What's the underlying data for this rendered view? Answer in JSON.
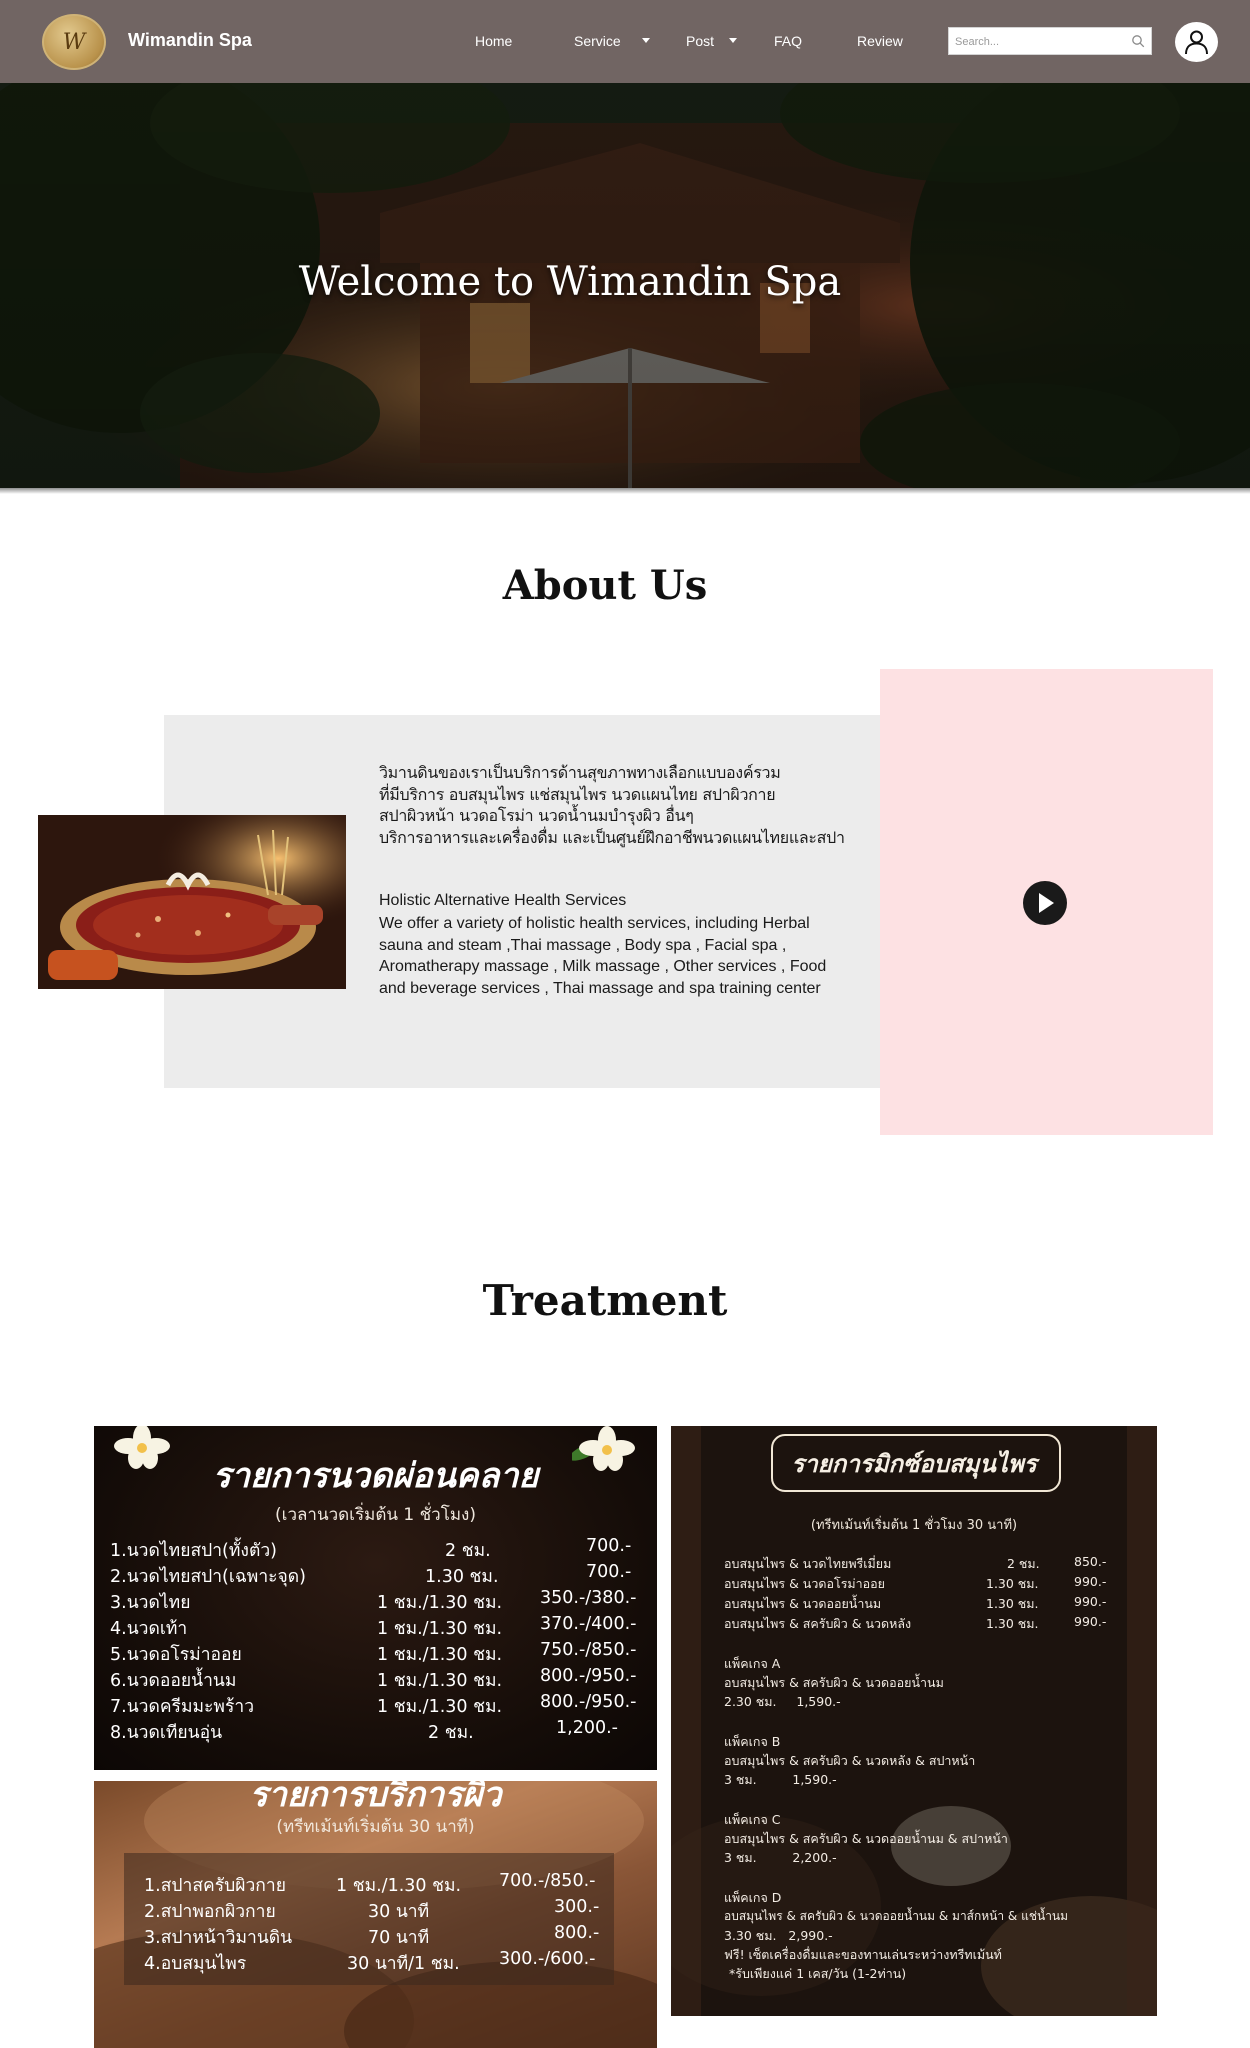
{
  "nav": {
    "brand": "Wimandin Spa",
    "logo_letter": "W",
    "items": [
      {
        "label": "Home",
        "dropdown": false
      },
      {
        "label": "Service",
        "dropdown": true
      },
      {
        "label": "Post",
        "dropdown": true
      },
      {
        "label": "FAQ",
        "dropdown": false
      },
      {
        "label": "Review",
        "dropdown": false
      }
    ],
    "search_placeholder": "Search...",
    "icons": {
      "search": "search-icon",
      "user": "user-icon"
    }
  },
  "hero": {
    "title": "Welcome to Wimandin Spa"
  },
  "about": {
    "title": "About Us",
    "thai_lines": [
      "วิมานดินของเราเป็นบริการด้านสุขภาพทางเลือกแบบองค์รวม",
      "ที่มีบริการ อบสมุนไพร แช่สมุนไพร นวดแผนไทย สปาผิวกาย",
      "สปาผิวหน้า นวดอโรม่า นวดน้ำนมบำรุงผิว อื่นๆ",
      "บริการอาหารและเครื่องดื่ม และเป็นศูนย์ฝึกอาชีพนวดแผนไทยและสปา"
    ],
    "english_title": "Holistic Alternative Health Services",
    "english_lines": [
      "We offer a variety of holistic health services, including Herbal",
      "sauna and steam ,Thai massage , Body spa , Facial spa ,",
      "Aromatherapy massage , Milk massage , Other services , Food",
      "and beverage services , Thai massage and spa training center"
    ],
    "video_icon": "play-icon"
  },
  "treatment": {
    "title": "Treatment",
    "massage_menu": {
      "title": "รายการนวดผ่อนคลาย",
      "subtitle": "(เวลานวดเริ่มต้น 1 ชั่วโมง)",
      "items": [
        {
          "name": "1.นวดไทยสปา(ทั้งตัว)",
          "duration": "2 ชม.",
          "price": "700.-"
        },
        {
          "name": "2.นวดไทยสปา(เฉพาะจุด)",
          "duration": "1.30 ชม.",
          "price": "700.-"
        },
        {
          "name": "3.นวดไทย",
          "duration": "1 ชม./1.30 ชม.",
          "price": "350.-/380.-"
        },
        {
          "name": "4.นวดเท้า",
          "duration": "1 ชม./1.30 ชม.",
          "price": "370.-/400.-"
        },
        {
          "name": "5.นวดอโรม่าออย",
          "duration": "1 ชม./1.30 ชม.",
          "price": "750.-/850.-"
        },
        {
          "name": "6.นวดออยน้ำนม",
          "duration": "1 ชม./1.30 ชม.",
          "price": "800.-/950.-"
        },
        {
          "name": "7.นวดครีมมะพร้าว",
          "duration": "1 ชม./1.30 ชม.",
          "price": "800.-/950.-"
        },
        {
          "name": "8.นวดเทียนอุ่น",
          "duration": "2  ชม.",
          "price": "1,200.-"
        }
      ]
    },
    "skin_menu": {
      "title": "รายการบริการผิว",
      "subtitle": "(ทรีทเม้นท์เริ่มต้น 30 นาที)",
      "items": [
        {
          "name": "1.สปาสครับผิวกาย",
          "duration": "1 ชม./1.30 ชม.",
          "price": "700.-/850.-"
        },
        {
          "name": "2.สปาพอกผิวกาย",
          "duration": "30 นาที",
          "price": "300.-"
        },
        {
          "name": "3.สปาหน้าวิมานดิน",
          "duration": "70 นาที",
          "price": "800.-"
        },
        {
          "name": "4.อบสมุนไพร",
          "duration": "30 นาที/1 ชม.",
          "price": "300.-/600.-"
        }
      ]
    },
    "herbal_menu": {
      "title": "รายการมิกซ์อบสมุนไพร",
      "subtitle": "(ทรีทเม้นท์เริ่มต้น  1 ชั่วโมง 30 นาที)",
      "items": [
        {
          "name": "อบสมุนไพร & นวดไทยพรีเมี่ยม",
          "duration": "2 ชม.",
          "price": "850.-"
        },
        {
          "name": "อบสมุนไพร & นวดอโรม่าออย",
          "duration": "1.30 ชม.",
          "price": "990.-"
        },
        {
          "name": "อบสมุนไพร & นวดออยน้ำนม",
          "duration": "1.30 ชม.",
          "price": "990.-"
        },
        {
          "name": "อบสมุนไพร & สครับผิว & นวดหลัง",
          "duration": "1.30 ชม.",
          "price": "990.-"
        }
      ],
      "packages": [
        {
          "name": "แพ็คเกจ A",
          "desc": "อบสมุนไพร & สครับผิว & นวดออยน้ำนม",
          "detail": "2.30 ชม.     1,590.-"
        },
        {
          "name": "แพ็คเกจ B",
          "desc": "อบสมุนไพร & สครับผิว & นวดหลัง & สปาหน้า",
          "detail": "3 ชม.         1,590.-"
        },
        {
          "name": "แพ็คเกจ C",
          "desc": "อบสมุนไพร & สครับผิว & นวดออยน้ำนม & สปาหน้า",
          "detail": "3 ชม.         2,200.-"
        },
        {
          "name": "แพ็คเกจ D",
          "desc": "อบสมุนไพร & สครับผิว &  นวดออยน้ำนม & มาส์กหน้า & แช่น้ำนม",
          "detail": "3.30 ชม.   2,990.-"
        }
      ],
      "promo": "ฟรี! เซ็ตเครื่องดื่มและของทานเล่นระหว่างทรีทเม้นท์",
      "note": "*รับเพียงแค่ 1 เคส/วัน (1-2ท่าน)"
    }
  },
  "colors": {
    "navbar": "#716563",
    "about_grey": "#ececec",
    "about_pink": "#fde1e3",
    "logo_gold": "#b9924b"
  }
}
